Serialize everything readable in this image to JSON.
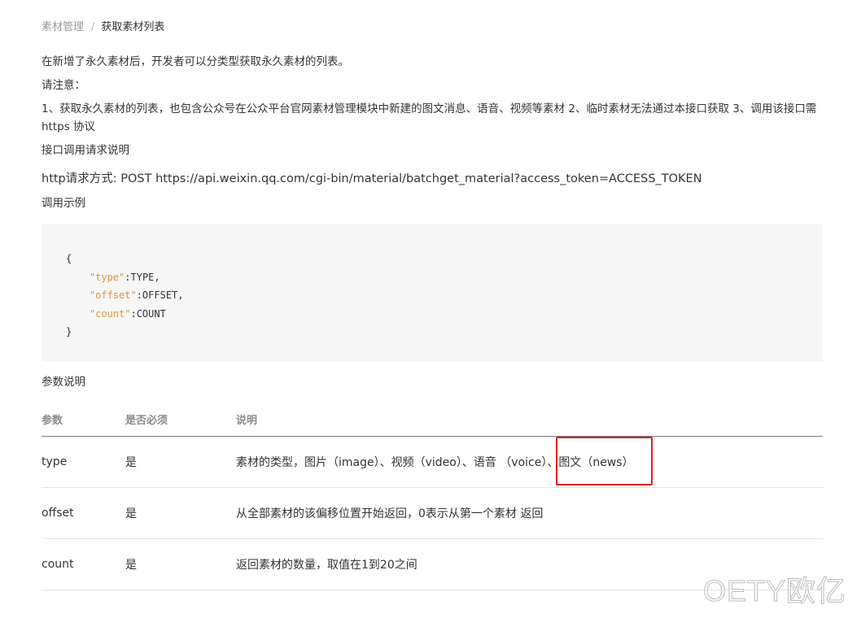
{
  "breadcrumb": {
    "parent": "素材管理",
    "separator": "/",
    "current": "获取素材列表"
  },
  "intro": {
    "line1": "在新增了永久素材后，开发者可以分类型获取永久素材的列表。",
    "notice_label": "请注意：",
    "notice_text": "1、获取永久素材的列表，也包含公众号在公众平台官网素材管理模块中新建的图文消息、语音、视频等素材 2、临时素材无法通过本接口获取 3、调用该接口需 https 协议",
    "request_label": "接口调用请求说明",
    "http_line": "http请求方式: POST https://api.weixin.qq.com/cgi-bin/material/batchget_material?access_token=ACCESS_TOKEN",
    "example_label": "调用示例"
  },
  "code": {
    "open": "{",
    "lines": [
      {
        "key": "\"type\"",
        "value": ":TYPE,"
      },
      {
        "key": "\"offset\"",
        "value": ":OFFSET,"
      },
      {
        "key": "\"count\"",
        "value": ":COUNT"
      }
    ],
    "close": "}"
  },
  "params": {
    "label": "参数说明",
    "headers": [
      "参数",
      "是否必须",
      "说明"
    ],
    "rows": [
      {
        "name": "type",
        "required": "是",
        "desc": "素材的类型，图片（image）、视频（video）、语音 （voice）、图文（news）"
      },
      {
        "name": "offset",
        "required": "是",
        "desc": "从全部素材的该偏移位置开始返回，0表示从第一个素材 返回"
      },
      {
        "name": "count",
        "required": "是",
        "desc": "返回素材的数量，取值在1到20之间"
      }
    ]
  },
  "watermark": "OETY欧亿",
  "colors": {
    "accent_code_key": "#e0963b",
    "highlight": "#e11e1e"
  }
}
